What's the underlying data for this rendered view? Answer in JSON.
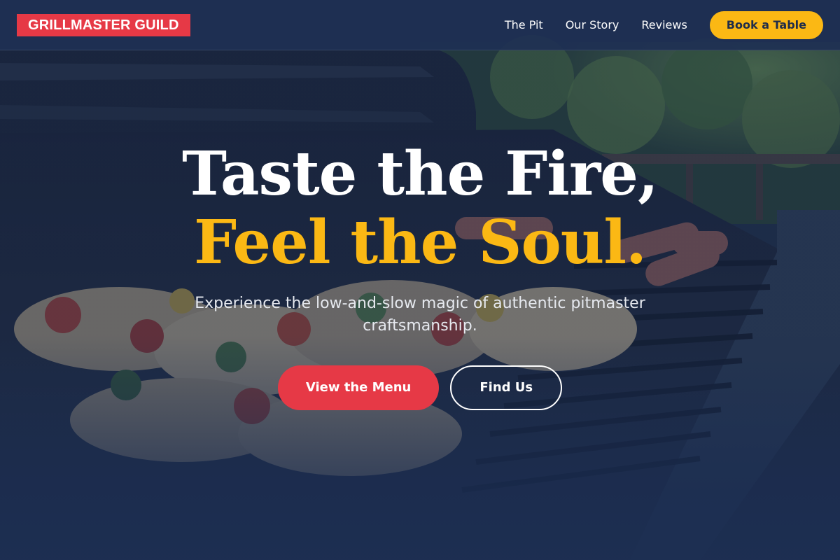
{
  "brand": {
    "name": "GRILLMASTER GUILD"
  },
  "nav": {
    "items": [
      {
        "label": "The Pit"
      },
      {
        "label": "Our Story"
      },
      {
        "label": "Reviews"
      }
    ],
    "cta_label": "Book a Table"
  },
  "hero": {
    "title_line1": "Taste the Fire,",
    "title_line2": "Feel the Soul.",
    "subtitle": "Experience the low-and-slow magic of authentic pitmaster craftsmanship.",
    "primary_button": "View the Menu",
    "secondary_button": "Find Us",
    "background_image": "grill-with-skewers-and-sausages"
  },
  "colors": {
    "brand_red": "#e63946",
    "accent_yellow": "#fbb814",
    "navy": "#1e2c4a"
  }
}
